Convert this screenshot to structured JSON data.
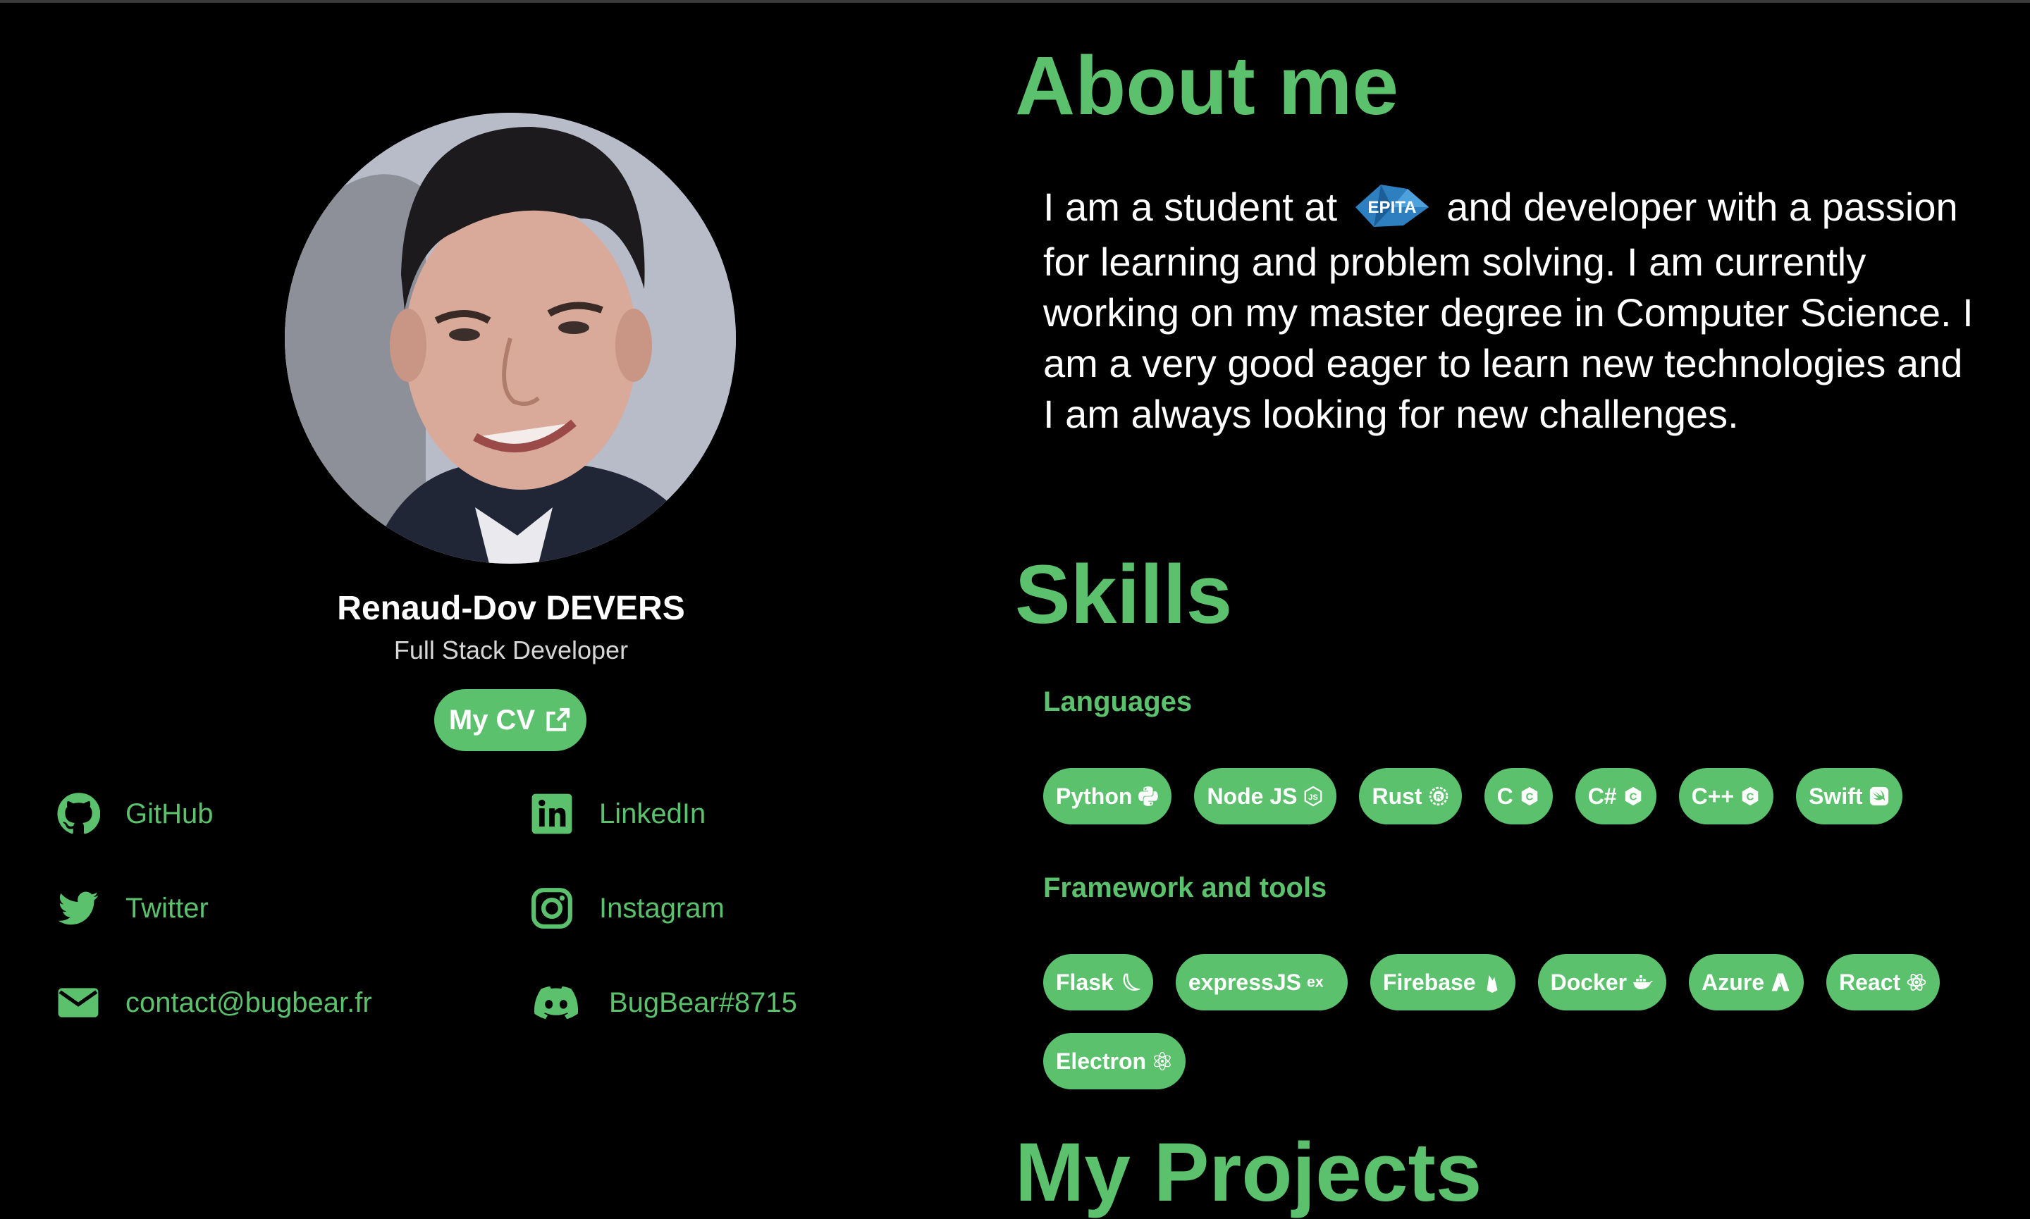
{
  "profile": {
    "name": "Renaud-Dov DEVERS",
    "role": "Full Stack Developer",
    "cv_label": "My CV",
    "avatar_alt": "profile-photo"
  },
  "socials": [
    {
      "label": "GitHub",
      "icon": "github-icon"
    },
    {
      "label": "LinkedIn",
      "icon": "linkedin-icon"
    },
    {
      "label": "Twitter",
      "icon": "twitter-icon"
    },
    {
      "label": "Instagram",
      "icon": "instagram-icon"
    },
    {
      "label": "contact@bugbear.fr",
      "icon": "mail-icon"
    },
    {
      "label": "BugBear#8715",
      "icon": "discord-icon"
    }
  ],
  "about": {
    "heading": "About me",
    "text_before_logo": "I am a student at",
    "logo_text": "EPITA",
    "text_after_logo": "and developer with a passion for learning and problem solving. I am currently working on my master degree in Computer Science. I am a very good eager to learn new technologies and I am always looking for new challenges."
  },
  "skills": {
    "heading": "Skills",
    "languages_heading": "Languages",
    "languages": [
      {
        "label": "Python",
        "icon": "python-icon"
      },
      {
        "label": "Node JS",
        "icon": "nodejs-icon"
      },
      {
        "label": "Rust",
        "icon": "rust-icon"
      },
      {
        "label": "C",
        "icon": "c-icon"
      },
      {
        "label": "C#",
        "icon": "csharp-icon"
      },
      {
        "label": "C++",
        "icon": "cpp-icon"
      },
      {
        "label": "Swift",
        "icon": "swift-icon"
      }
    ],
    "tools_heading": "Framework and tools",
    "tools": [
      {
        "label": "Flask",
        "icon": "flask-icon"
      },
      {
        "label": "expressJS",
        "icon": "express-icon"
      },
      {
        "label": "Firebase",
        "icon": "firebase-icon"
      },
      {
        "label": "Docker",
        "icon": "docker-icon"
      },
      {
        "label": "Azure",
        "icon": "azure-icon"
      },
      {
        "label": "React",
        "icon": "react-icon"
      },
      {
        "label": "Electron",
        "icon": "electron-icon"
      }
    ]
  },
  "projects": {
    "heading": "My Projects"
  },
  "colors": {
    "accent": "#5cc16d",
    "background": "#000000",
    "text": "#ffffff"
  }
}
